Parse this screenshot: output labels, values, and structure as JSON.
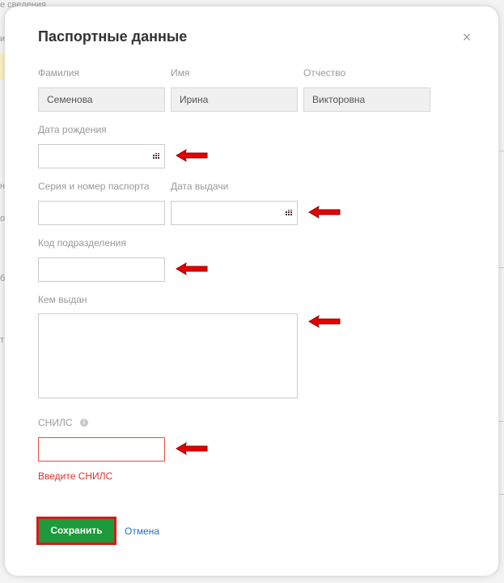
{
  "background": {
    "fragments": [
      "е сведения",
      "и",
      "н",
      "о",
      "б",
      "т"
    ]
  },
  "modal": {
    "title": "Паспортные данные",
    "close_icon": "close-icon",
    "fields": {
      "last_name": {
        "label": "Фамилия",
        "value": "Семенова"
      },
      "first_name": {
        "label": "Имя",
        "value": "Ирина"
      },
      "patronymic": {
        "label": "Отчество",
        "value": "Викторовна"
      },
      "birth_date": {
        "label": "Дата рождения",
        "value": "",
        "icon": "calendar-icon"
      },
      "passport_number": {
        "label": "Серия и номер паспорта",
        "value": ""
      },
      "issue_date": {
        "label": "Дата выдачи",
        "value": "",
        "icon": "calendar-icon"
      },
      "division_code": {
        "label": "Код подразделения",
        "value": ""
      },
      "issued_by": {
        "label": "Кем выдан",
        "value": ""
      },
      "snils": {
        "label": "СНИЛС",
        "value": "",
        "help_icon": "help-icon",
        "error": "Введите СНИЛС"
      }
    },
    "buttons": {
      "save": "Сохранить",
      "cancel": "Отмена"
    }
  },
  "colors": {
    "save_button": "#1d9a3b",
    "highlight": "#d51b1b",
    "error": "#e0302a",
    "link": "#2a6fc4"
  }
}
